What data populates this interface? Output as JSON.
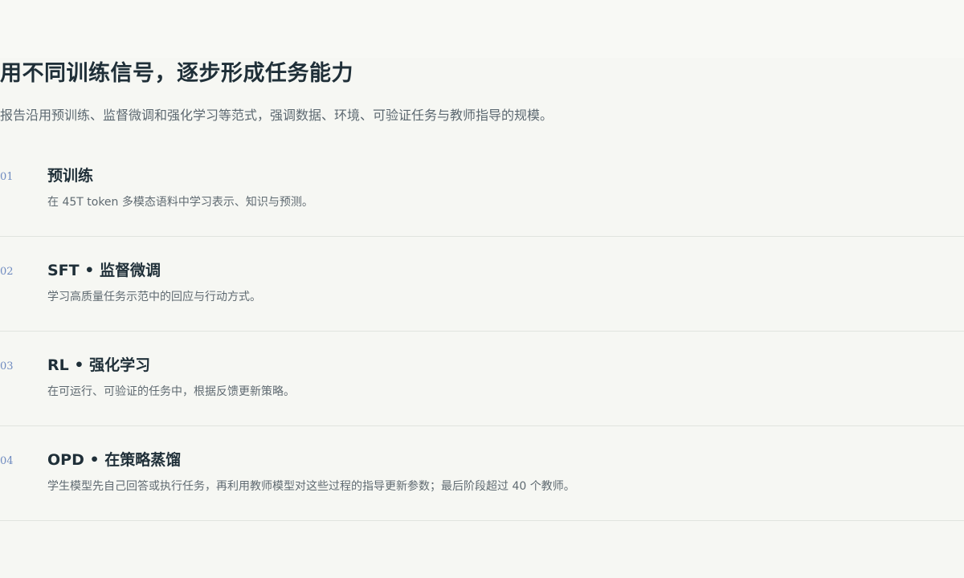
{
  "header": {
    "title": "用不同训练信号，逐步形成任务能力",
    "subtitle": "报告沿用预训练、监督微调和强化学习等范式，强调数据、环境、可验证任务与教师指导的规模。"
  },
  "steps": [
    {
      "number": "01",
      "title": "预训练",
      "description": "在 45T token 多模态语料中学习表示、知识与预测。"
    },
    {
      "number": "02",
      "title": "SFT • 监督微调",
      "description": "学习高质量任务示范中的回应与行动方式。"
    },
    {
      "number": "03",
      "title": "RL • 强化学习",
      "description": "在可运行、可验证的任务中，根据反馈更新策略。"
    },
    {
      "number": "04",
      "title": "OPD • 在策略蒸馏",
      "description": "学生模型先自己回答或执行任务，再利用教师模型对这些过程的指导更新参数；最后阶段超过 40 个教师。"
    }
  ]
}
